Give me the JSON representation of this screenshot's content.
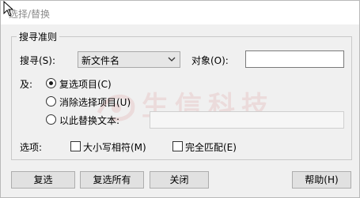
{
  "window": {
    "title": "选择/替换"
  },
  "group": {
    "legend": "搜寻准则"
  },
  "search": {
    "label": "搜寻(S):",
    "selected": "新文件名",
    "object_label": "对象(O):",
    "object_value": ""
  },
  "scope": {
    "label": "及:",
    "options": [
      {
        "label": "复选项目(C)",
        "checked": true
      },
      {
        "label": "消除选择项目(U)",
        "checked": false
      },
      {
        "label": "以此替换文本:",
        "checked": false
      }
    ],
    "replace_value": ""
  },
  "options": {
    "label": "选项:",
    "match_case": "大小写相符(M)",
    "match_whole": "完全匹配(E)"
  },
  "buttons": {
    "select": "复选",
    "select_all": "复选所有",
    "close": "关闭",
    "help": "帮助(H)"
  },
  "watermark": {
    "text": "生信科技"
  },
  "colors": {
    "title_text": "#8c8c8c",
    "watermark": "#d66e6e"
  }
}
